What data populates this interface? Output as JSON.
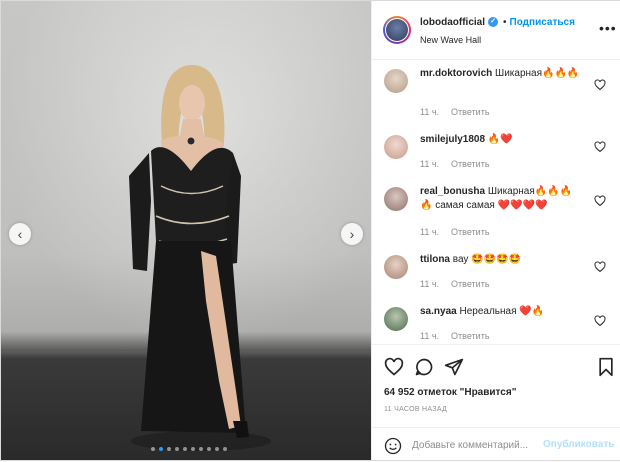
{
  "post": {
    "username": "lobodaofficial",
    "follow_label": "Подписаться",
    "separator": "•",
    "location": "New Wave Hall",
    "more_icon": "ellipsis-icon"
  },
  "media": {
    "prev_arrow": "‹",
    "next_arrow": "›",
    "carousel_count": 10,
    "active_index": 1
  },
  "comments": [
    {
      "user": "mr.doktorovich",
      "text": "Шикарная🔥🔥🔥",
      "time": "11 ч.",
      "reply": "Ответить"
    },
    {
      "user": "smilejuly1808",
      "text": "🔥❤️",
      "time": "11 ч.",
      "reply": "Ответить"
    },
    {
      "user": "real_bonusha",
      "text": "Шикарная🔥🔥🔥🔥 самая самая ❤️❤️❤️❤️",
      "time": "11 ч.",
      "reply": "Ответить"
    },
    {
      "user": "ttilona",
      "text": "вау 🤩🤩🤩🤩",
      "time": "11 ч.",
      "reply": "Ответить"
    },
    {
      "user": "sa.nyaa",
      "text": "Нереальная ❤️🔥",
      "time": "11 ч.",
      "reply": "Ответить"
    }
  ],
  "footer": {
    "likes": "64 952 отметок \"Нравится\"",
    "time_ago": "11 ЧАСОВ НАЗАД",
    "comment_placeholder": "Добавьте комментарий...",
    "publish_label": "Опубликовать"
  },
  "colors": {
    "accent": "#0095f6",
    "publish_disabled": "#b2dffc",
    "like_red": "#ed4956",
    "muted": "#8e8e8e"
  }
}
